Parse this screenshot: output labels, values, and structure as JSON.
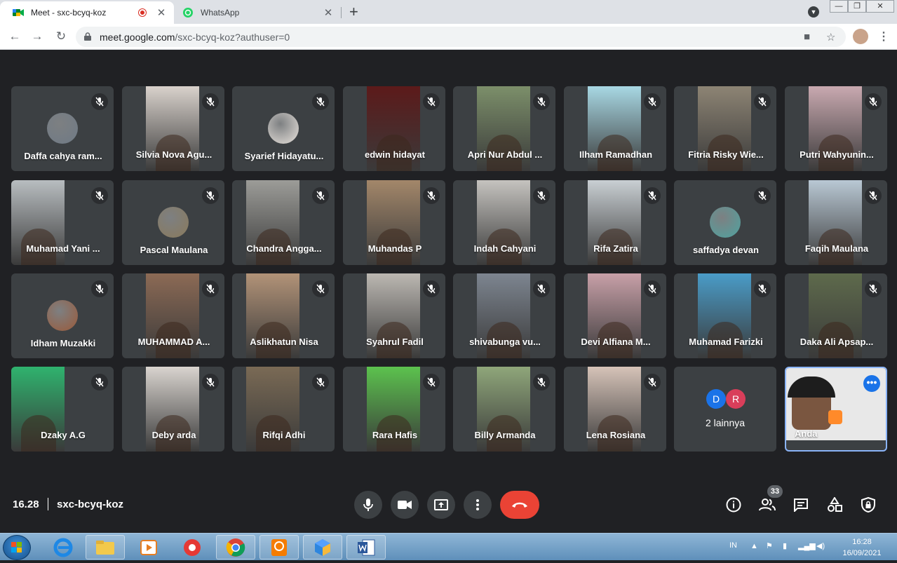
{
  "browser": {
    "tabs": [
      {
        "title": "Meet - sxc-bcyq-koz",
        "recording": true
      },
      {
        "title": "WhatsApp"
      }
    ],
    "url_host": "meet.google.com",
    "url_path": "/sxc-bcyq-koz?authuser=0"
  },
  "participants": [
    {
      "name": "Daffa cahya ram...",
      "kind": "avatar",
      "bg": "#6f7a86"
    },
    {
      "name": "Silvia Nova Agu...",
      "kind": "video",
      "bg": "#d9d2cc"
    },
    {
      "name": "Syarief Hidayatu...",
      "kind": "avatar",
      "bg": "#e8e2dc"
    },
    {
      "name": "edwin hidayat",
      "kind": "video",
      "bg": "#5c1a1a"
    },
    {
      "name": "Apri Nur Abdul ...",
      "kind": "video",
      "bg": "#7c8f6a"
    },
    {
      "name": "Ilham Ramadhan",
      "kind": "video",
      "bg": "#a8d8e4"
    },
    {
      "name": "Fitria Risky Wie...",
      "kind": "video",
      "bg": "#8d8474"
    },
    {
      "name": "Putri Wahyunin...",
      "kind": "video",
      "bg": "#c9a9b0"
    },
    {
      "name": "Muhamad Yani ...",
      "kind": "video",
      "bg": "#b8bdc0"
    },
    {
      "name": "Pascal Maulana",
      "kind": "avatar",
      "bg": "#8a7a5c"
    },
    {
      "name": "Chandra Angga...",
      "kind": "video",
      "bg": "#9c9c98"
    },
    {
      "name": "Muhandas P",
      "kind": "video",
      "bg": "#a3876a"
    },
    {
      "name": "Indah Cahyani",
      "kind": "video",
      "bg": "#c5c3bf"
    },
    {
      "name": "Rifa Zatira",
      "kind": "video",
      "bg": "#c9cfd3"
    },
    {
      "name": "saffadya devan",
      "kind": "avatar",
      "bg": "#4fa3a0"
    },
    {
      "name": "Faqih Maulana",
      "kind": "video",
      "bg": "#b9c8d4"
    },
    {
      "name": "Idham Muzakki",
      "kind": "avatar",
      "bg": "#9a5a3a"
    },
    {
      "name": "MUHAMMAD A...",
      "kind": "video",
      "bg": "#8c6a55"
    },
    {
      "name": "Aslikhatun Nisa",
      "kind": "video",
      "bg": "#b29378"
    },
    {
      "name": "Syahrul Fadil",
      "kind": "video",
      "bg": "#bcb8b2"
    },
    {
      "name": "shivabunga vu...",
      "kind": "video",
      "bg": "#7d8590"
    },
    {
      "name": "Devi Alfiana M...",
      "kind": "video",
      "bg": "#c8a0a8"
    },
    {
      "name": "Muhamad Farizki",
      "kind": "video",
      "bg": "#4a9cc8"
    },
    {
      "name": "Daka Ali Apsap...",
      "kind": "video",
      "bg": "#5e6a4c"
    },
    {
      "name": "Dzaky A.G",
      "kind": "video",
      "bg": "#2fb36e"
    },
    {
      "name": "Deby arda",
      "kind": "video",
      "bg": "#d9d4cf"
    },
    {
      "name": "Rifqi Adhi",
      "kind": "video",
      "bg": "#7a6a55"
    },
    {
      "name": "Rara Hafis",
      "kind": "video",
      "bg": "#5cc24e"
    },
    {
      "name": "Billy Armanda",
      "kind": "video",
      "bg": "#8fa67a"
    },
    {
      "name": "Lena Rosiana",
      "kind": "video",
      "bg": "#d6c3b8"
    }
  ],
  "others": {
    "label": "2 lainnya",
    "initials": [
      "D",
      "R"
    ],
    "colors": [
      "#1a73e8",
      "#d93e5a"
    ]
  },
  "self": {
    "name": "Anda"
  },
  "meeting": {
    "time": "16.28",
    "code": "sxc-bcyq-koz",
    "participant_count": "33"
  },
  "system": {
    "lang": "IN",
    "time": "16:28",
    "date": "16/09/2021"
  },
  "colors": {
    "meet_bg": "#202124",
    "tile_bg": "#3c4043",
    "end_call": "#ea4335",
    "self_border": "#8ab4f8"
  }
}
